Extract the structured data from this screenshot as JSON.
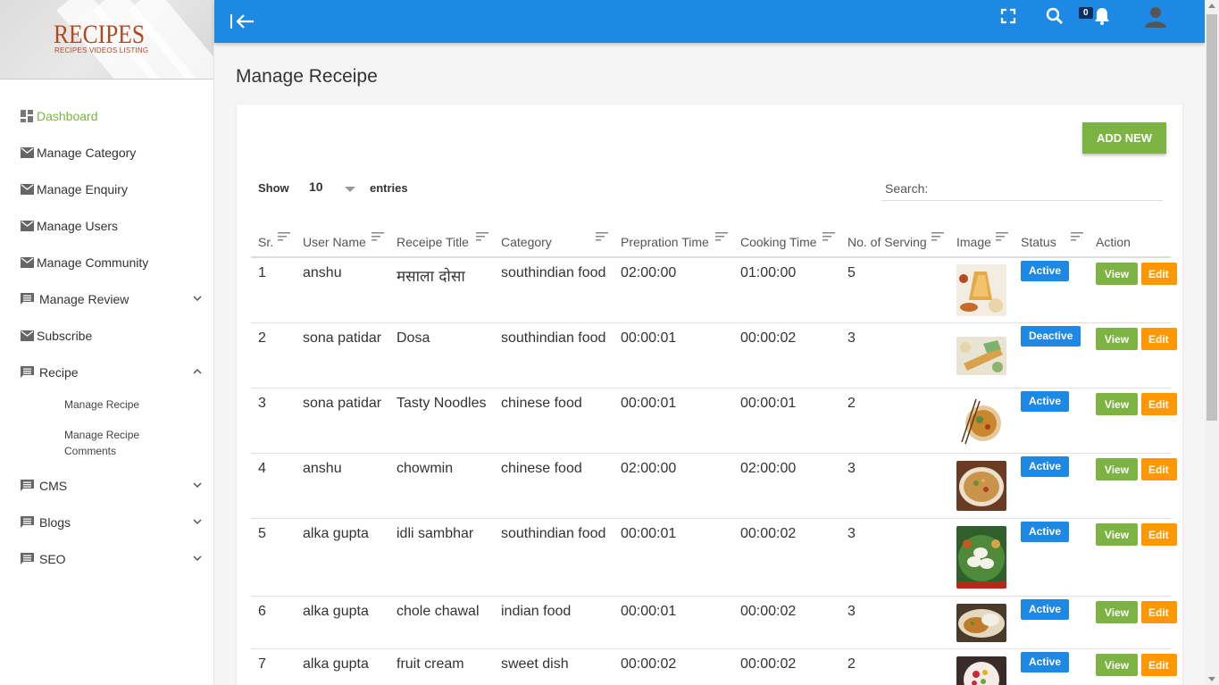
{
  "logo": {
    "title": "RECIPES",
    "subtitle": "RECIPES VIDEOS LISTING"
  },
  "sidebar": {
    "items": [
      {
        "label": "Dashboard",
        "icon": "dashboard-icon",
        "active": true
      },
      {
        "label": "Manage Category",
        "icon": "mail-icon"
      },
      {
        "label": "Manage Enquiry",
        "icon": "mail-icon"
      },
      {
        "label": "Manage Users",
        "icon": "mail-icon"
      },
      {
        "label": "Manage Community",
        "icon": "mail-icon"
      },
      {
        "label": "Manage Review",
        "icon": "comment-icon",
        "chevron": "down"
      },
      {
        "label": "Subscribe",
        "icon": "mail-icon"
      },
      {
        "label": "Recipe",
        "icon": "comment-icon",
        "chevron": "up"
      },
      {
        "label": "CMS",
        "icon": "comment-icon",
        "chevron": "down"
      },
      {
        "label": "Blogs",
        "icon": "comment-icon",
        "chevron": "down"
      },
      {
        "label": "SEO",
        "icon": "comment-icon",
        "chevron": "down"
      }
    ],
    "recipe_sub": [
      "Manage Recipe",
      "Manage Recipe Comments"
    ]
  },
  "topbar": {
    "notification_count": "0",
    "accent": "#1e88e5"
  },
  "page": {
    "title": "Manage Receipe",
    "add_new": "ADD NEW"
  },
  "table_controls": {
    "show_label": "Show",
    "page_size": "10",
    "entries_label": "entries",
    "search_label": "Search:",
    "search_value": ""
  },
  "table": {
    "columns": [
      "Sr.",
      "User Name",
      "Receipe Title",
      "Category",
      "Prepration Time",
      "Cooking Time",
      "No. of Serving",
      "Image",
      "Status",
      "Action"
    ],
    "rows": [
      {
        "sr": "1",
        "user": "anshu",
        "title": "मसाला दोसा",
        "category": "southindian food",
        "prep": "02:00:00",
        "cook": "01:00:00",
        "serving": "5",
        "image": "dosa-plate",
        "status": "Active",
        "view": "View",
        "edit": "Edit"
      },
      {
        "sr": "2",
        "user": "sona patidar",
        "title": "Dosa",
        "category": "southindian food",
        "prep": "00:00:01",
        "cook": "00:00:02",
        "serving": "3",
        "image": "dosa-roll",
        "status": "Deactive",
        "view": "View",
        "edit": "Edit"
      },
      {
        "sr": "3",
        "user": "sona patidar",
        "title": "Tasty Noodles",
        "category": "chinese food",
        "prep": "00:00:01",
        "cook": "00:00:01",
        "serving": "2",
        "image": "noodle-bowl",
        "status": "Active",
        "view": "View",
        "edit": "Edit"
      },
      {
        "sr": "4",
        "user": "anshu",
        "title": "chowmin",
        "category": "chinese food",
        "prep": "02:00:00",
        "cook": "02:00:00",
        "serving": "3",
        "image": "chowmin-plate",
        "status": "Active",
        "view": "View",
        "edit": "Edit"
      },
      {
        "sr": "5",
        "user": "alka gupta",
        "title": "idli sambhar",
        "category": "southindian food",
        "prep": "00:00:01",
        "cook": "00:00:02",
        "serving": "3",
        "image": "idli-plate",
        "status": "Active",
        "view": "View",
        "edit": "Edit"
      },
      {
        "sr": "6",
        "user": "alka gupta",
        "title": "chole chawal",
        "category": "indian food",
        "prep": "00:00:01",
        "cook": "00:00:02",
        "serving": "3",
        "image": "chole-plate",
        "status": "Active",
        "view": "View",
        "edit": "Edit"
      },
      {
        "sr": "7",
        "user": "alka gupta",
        "title": "fruit cream",
        "category": "sweet dish",
        "prep": "00:00:02",
        "cook": "00:00:02",
        "serving": "2",
        "image": "fruit-cream",
        "status": "Active",
        "view": "View",
        "edit": "Edit"
      }
    ]
  }
}
